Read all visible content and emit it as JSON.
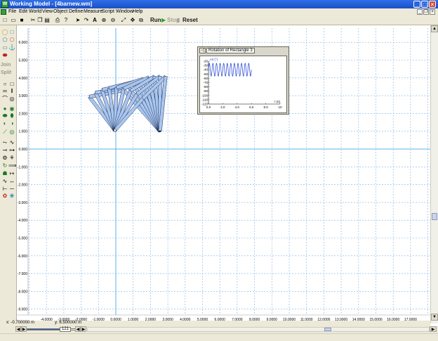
{
  "window": {
    "title": "Working Model - [4barnew.wm]"
  },
  "menu": [
    {
      "id": "file",
      "label": "File"
    },
    {
      "id": "edit",
      "label": "Edit"
    },
    {
      "id": "world",
      "label": "World"
    },
    {
      "id": "view",
      "label": "View"
    },
    {
      "id": "object",
      "label": "Object"
    },
    {
      "id": "define",
      "label": "Define"
    },
    {
      "id": "measure",
      "label": "Measure"
    },
    {
      "id": "script",
      "label": "Script"
    },
    {
      "id": "window",
      "label": "Window"
    },
    {
      "id": "help",
      "label": "Help"
    }
  ],
  "toolbar": {
    "run": "Run",
    "stop": "Stop",
    "reset": "Reset",
    "text_tool": "A"
  },
  "palette": {
    "join": "Join",
    "split": "Split"
  },
  "status": {
    "x_label": "x: -0.700000 m",
    "y_label": "y: 6.500000 m"
  },
  "tape": {
    "frame": "121",
    "progress_fraction": 0.78
  },
  "axes": {
    "x_ticks": [
      "-4.0000",
      "-3.0000",
      "-2.0000",
      "-1.0000",
      "0.0000",
      "1.0000",
      "2.0000",
      "3.0000",
      "4.0000",
      "5.0000",
      "6.0000",
      "7.0000",
      "8.0000",
      "9.0000",
      "10.0000",
      "11.0000",
      "12.0000",
      "13.0000",
      "14.0000",
      "15.0000",
      "16.0000",
      "17.0000"
    ],
    "y_ticks": [
      "6.000",
      "5.000",
      "4.000",
      "3.000",
      "2.000",
      "1.000",
      "0.000",
      "-1.000",
      "-2.000",
      "-3.000",
      "-4.000",
      "-5.000",
      "-6.000",
      "-7.000",
      "-8.000",
      "-9.000"
    ]
  },
  "meter": {
    "title": "Rotation of Rectangle 3",
    "toggle": "◁",
    "ylabel": "rot (°)",
    "xlabel": "t (s)",
    "y_ticks": [
      "-20",
      "-30",
      "-40",
      "-50",
      "-60",
      "-70",
      "-80",
      "-90",
      "-100",
      "-110",
      "-120"
    ],
    "x_ticks": [
      "0.0",
      "2.0",
      "4.0",
      "6.0",
      "8.0",
      "10"
    ]
  },
  "chart_data": {
    "type": "line",
    "title": "Rotation of Rectangle 3",
    "xlabel": "t (s)",
    "ylabel": "rot (°)",
    "xlim": [
      0,
      10
    ],
    "ylim": [
      -120,
      -20
    ],
    "series": [
      {
        "name": "",
        "min": -55,
        "max": -25,
        "period": 0.5,
        "t_end": 6.0
      }
    ]
  },
  "colors": {
    "link_fill": "#a9c6ee",
    "link_stroke": "#1a2a55",
    "grid": "#7fb2e6",
    "axis": "#5ab3e8",
    "meter_line": "#1f3fd1"
  },
  "icons": {
    "pointer": "arrow-icon",
    "rotate": "rotate-icon",
    "zoom_in": "zoom-in-icon",
    "zoom_out": "zoom-out-icon",
    "home": "home-icon",
    "open": "open-icon",
    "save": "save-icon",
    "new": "new-icon",
    "cut": "cut-icon",
    "copy": "copy-icon",
    "paste": "paste-icon",
    "print": "print-icon",
    "help": "help-icon"
  }
}
